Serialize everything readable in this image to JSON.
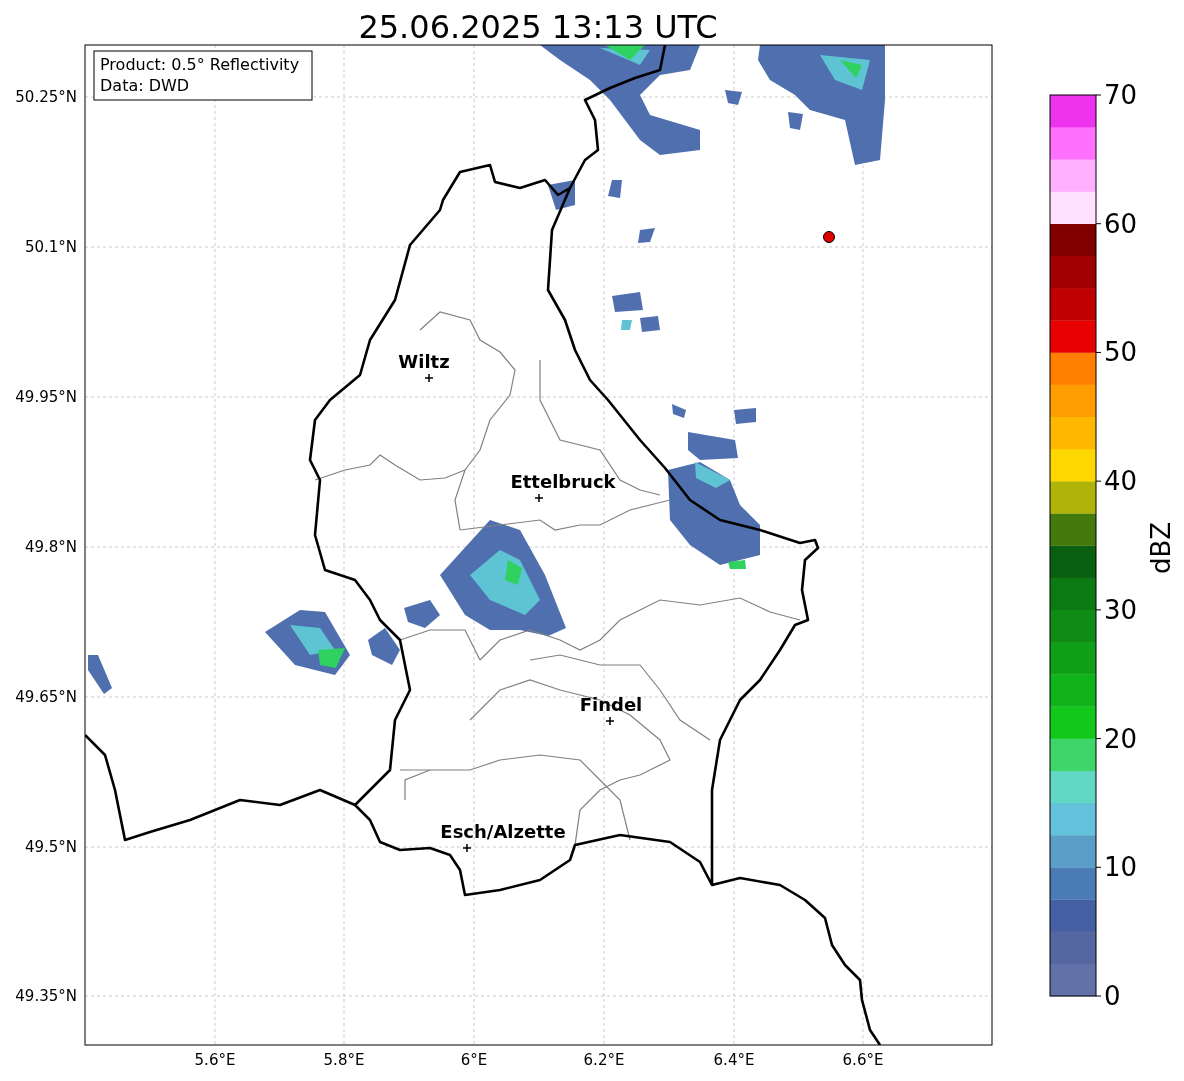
{
  "title": "25.06.2025 13:13 UTC",
  "info_box": {
    "lines": [
      "Product: 0.5° Reflectivity",
      "Data: DWD"
    ]
  },
  "map": {
    "lat_labels": [
      "50.25°N",
      "50.1°N",
      "49.95°N",
      "49.8°N",
      "49.65°N",
      "49.5°N",
      "49.35°N"
    ],
    "lon_labels": [
      "5.6°E",
      "5.8°E",
      "6°E",
      "6.2°E",
      "6.4°E",
      "6.6°E"
    ],
    "cities": [
      {
        "name": "Wiltz"
      },
      {
        "name": "Ettelbruck"
      },
      {
        "name": "Findel"
      },
      {
        "name": "Esch/Alzette"
      }
    ]
  },
  "colorbar": {
    "label": "dBZ",
    "ticks": [
      "70",
      "60",
      "50",
      "40",
      "30",
      "20",
      "10",
      "0"
    ],
    "bands": [
      {
        "color": "#6272a8"
      },
      {
        "color": "#5467a0"
      },
      {
        "color": "#4460a3"
      },
      {
        "color": "#4a7bb5"
      },
      {
        "color": "#5a9ec8"
      },
      {
        "color": "#64c1dc"
      },
      {
        "color": "#62d8c4"
      },
      {
        "color": "#3ed66b"
      },
      {
        "color": "#12c81a"
      },
      {
        "color": "#10b41a"
      },
      {
        "color": "#10a018"
      },
      {
        "color": "#0f8c14"
      },
      {
        "color": "#0c7a12"
      },
      {
        "color": "#0a6010"
      },
      {
        "color": "#447a0c"
      },
      {
        "color": "#b0b40a"
      },
      {
        "color": "#ffd700"
      },
      {
        "color": "#ffb800"
      },
      {
        "color": "#ff9c00"
      },
      {
        "color": "#ff7f00"
      },
      {
        "color": "#e60000"
      },
      {
        "color": "#c00000"
      },
      {
        "color": "#a00000"
      },
      {
        "color": "#800000"
      },
      {
        "color": "#ffe0ff"
      },
      {
        "color": "#ffb0ff"
      },
      {
        "color": "#ff70ff"
      },
      {
        "color": "#ee33ee"
      }
    ]
  }
}
